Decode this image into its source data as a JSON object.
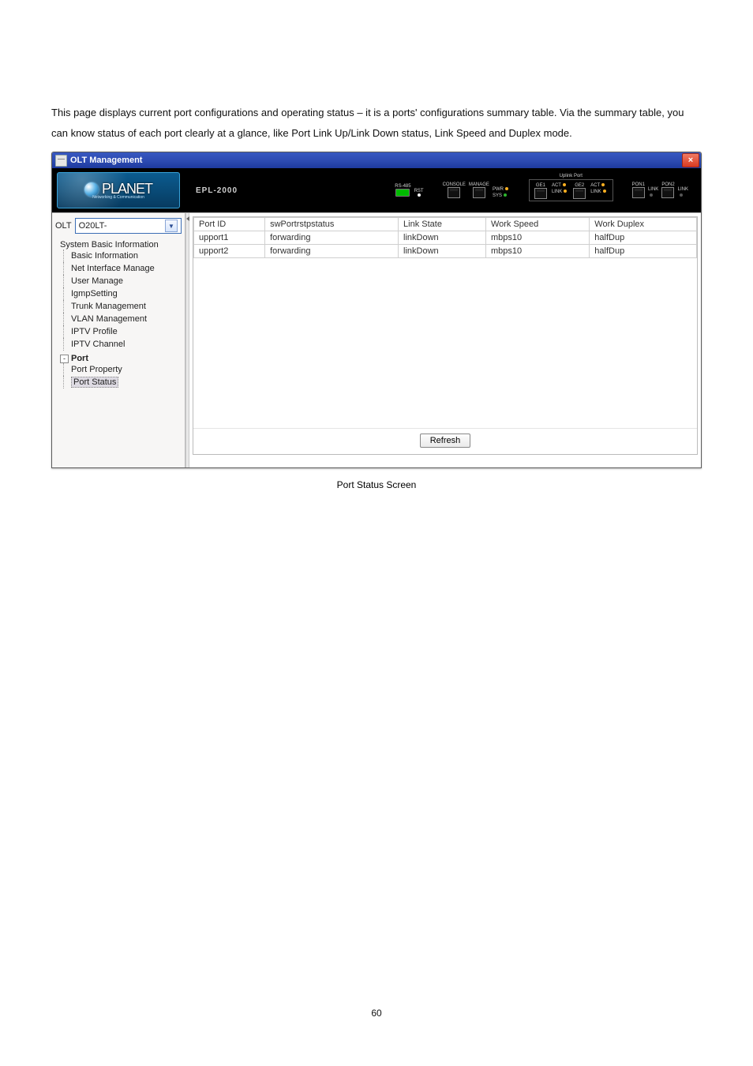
{
  "intro": "This page displays current port configurations and operating status – it is a ports' configurations summary table. Via the summary table, you can know status of each port clearly at a glance, like Port Link Up/Link Down status, Link Speed and Duplex mode.",
  "window": {
    "title": "OLT Management",
    "close": "×"
  },
  "device": {
    "brand": "PLANET",
    "brand_sub": "Networking & Communication",
    "model": "EPL-2000",
    "console_label": "CONSOLE",
    "manage_label": "MANAGE",
    "rs485_label": "RS-485",
    "rst_label": "RST",
    "pwr_label": "PWR",
    "sys_label": "SYS",
    "uplink_label": "Uplink Port",
    "ge1_label": "GE1",
    "ge2_label": "GE2",
    "pon1_label": "PON1",
    "pon2_label": "PON2",
    "act_label": "ACT",
    "link_label": "LINK"
  },
  "sidebar": {
    "olt_label": "OLT",
    "olt_selected": "O20LT-",
    "tree": {
      "root": "System Basic Information",
      "items": [
        "Basic Information",
        "Net Interface Manage",
        "User Manage",
        "IgmpSetting",
        "Trunk Management",
        "VLAN Management",
        "IPTV Profile",
        "IPTV Channel"
      ],
      "port_label": "Port",
      "port_children": {
        "property": "Port Property",
        "status": "Port Status"
      }
    }
  },
  "table": {
    "headers": [
      "Port ID",
      "swPortrstpstatus",
      "Link State",
      "Work Speed",
      "Work Duplex"
    ],
    "rows": [
      [
        "upport1",
        "forwarding",
        "linkDown",
        "mbps10",
        "halfDup"
      ],
      [
        "upport2",
        "forwarding",
        "linkDown",
        "mbps10",
        "halfDup"
      ]
    ],
    "refresh": "Refresh"
  },
  "caption": "Port Status Screen",
  "page_number": "60"
}
